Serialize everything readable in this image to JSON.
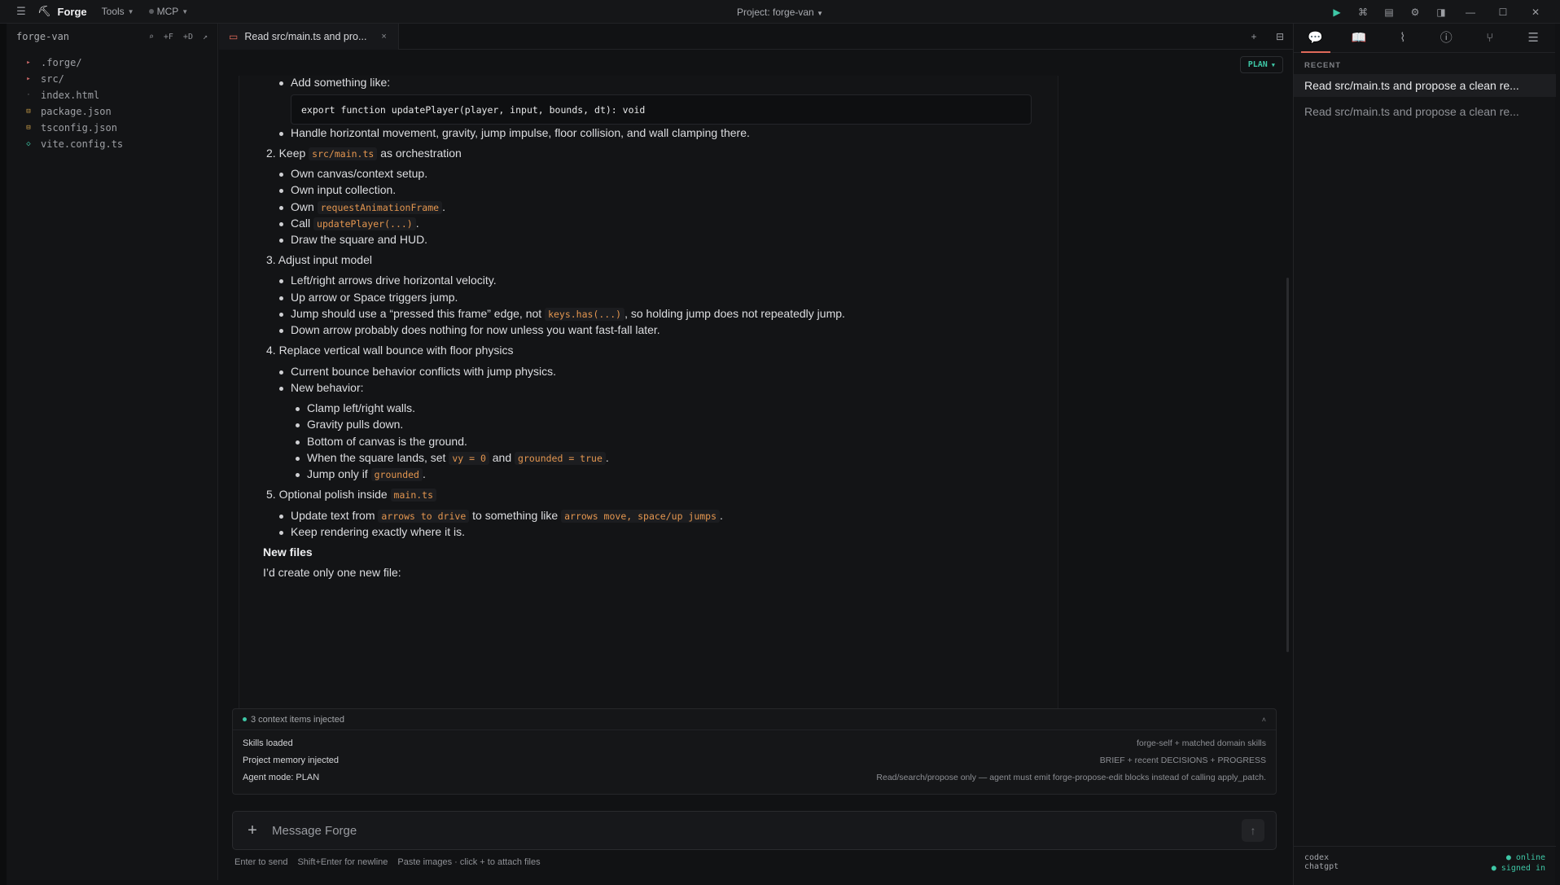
{
  "titlebar": {
    "app_name": "Forge",
    "menu_tools": "Tools",
    "menu_mcp": "MCP",
    "project_title": "Project: forge-van"
  },
  "sidebar": {
    "project_name": "forge-van",
    "actions": [
      "⌕",
      "+F",
      "+D",
      "↗"
    ],
    "files": [
      {
        "name": ".forge/",
        "type": "folder"
      },
      {
        "name": "src/",
        "type": "folder"
      },
      {
        "name": "index.html",
        "type": "html"
      },
      {
        "name": "package.json",
        "type": "json"
      },
      {
        "name": "tsconfig.json",
        "type": "json"
      },
      {
        "name": "vite.config.ts",
        "type": "ts"
      }
    ]
  },
  "tab": {
    "title": "Read src/main.ts and pro..."
  },
  "plan_badge": "PLAN",
  "doc": {
    "l1": "Add something like:",
    "code1": "export function updatePlayer(player, input, bounds, dt): void",
    "l2": "Handle horizontal movement, gravity, jump impulse, floor collision, and wall clamping there.",
    "s2_pre": "2. Keep ",
    "s2_code": "src/main.ts",
    "s2_post": " as orchestration",
    "l3": "Own canvas/context setup.",
    "l4": "Own input collection.",
    "l5_pre": "Own ",
    "l5_code": "requestAnimationFrame",
    "l5_post": ".",
    "l6_pre": "Call ",
    "l6_code": "updatePlayer(...)",
    "l6_post": ".",
    "l7": "Draw the square and HUD.",
    "s3": "3. Adjust input model",
    "l8": "Left/right arrows drive horizontal velocity.",
    "l9": "Up arrow or Space triggers jump.",
    "l10_pre": "Jump should use a “pressed this frame” edge, not ",
    "l10_code": "keys.has(...)",
    "l10_post": ", so holding jump does not repeatedly jump.",
    "l11": "Down arrow probably does nothing for now unless you want fast-fall later.",
    "s4": "4. Replace vertical wall bounce with floor physics",
    "l12": "Current bounce behavior conflicts with jump physics.",
    "l13": "New behavior:",
    "l14": "Clamp left/right walls.",
    "l15": "Gravity pulls down.",
    "l16": "Bottom of canvas is the ground.",
    "l17_pre": "When the square lands, set ",
    "l17_code1": "vy = 0",
    "l17_mid": " and ",
    "l17_code2": "grounded = true",
    "l17_post": ".",
    "l18_pre": "Jump only if ",
    "l18_code": "grounded",
    "l18_post": ".",
    "s5_pre": "5. Optional polish inside ",
    "s5_code": "main.ts",
    "l19_pre": "Update text from ",
    "l19_code1": "arrows to drive",
    "l19_mid": " to something like ",
    "l19_code2": "arrows move, space/up jumps",
    "l19_post": ".",
    "l20": "Keep rendering exactly where it is.",
    "h_newfiles": "New files",
    "l21": "I’d create only one new file:"
  },
  "context": {
    "header": "3 context items injected",
    "rows": [
      {
        "k": "Skills loaded",
        "v": "forge-self + matched domain skills"
      },
      {
        "k": "Project memory injected",
        "v": "BRIEF + recent DECISIONS + PROGRESS"
      },
      {
        "k": "Agent mode: PLAN",
        "v": "Read/search/propose only — agent must emit forge-propose-edit blocks instead of calling apply_patch."
      }
    ]
  },
  "composer": {
    "placeholder": "Message Forge",
    "hints": [
      "Enter to send",
      "Shift+Enter for newline",
      "Paste images · click + to attach files"
    ]
  },
  "right": {
    "recent_label": "RECENT",
    "items": [
      "Read src/main.ts and propose a clean re...",
      "Read src/main.ts and propose a clean re..."
    ],
    "footer_l1": "codex",
    "footer_l2": "chatgpt",
    "footer_r1": "● online",
    "footer_r2": "● signed in"
  }
}
